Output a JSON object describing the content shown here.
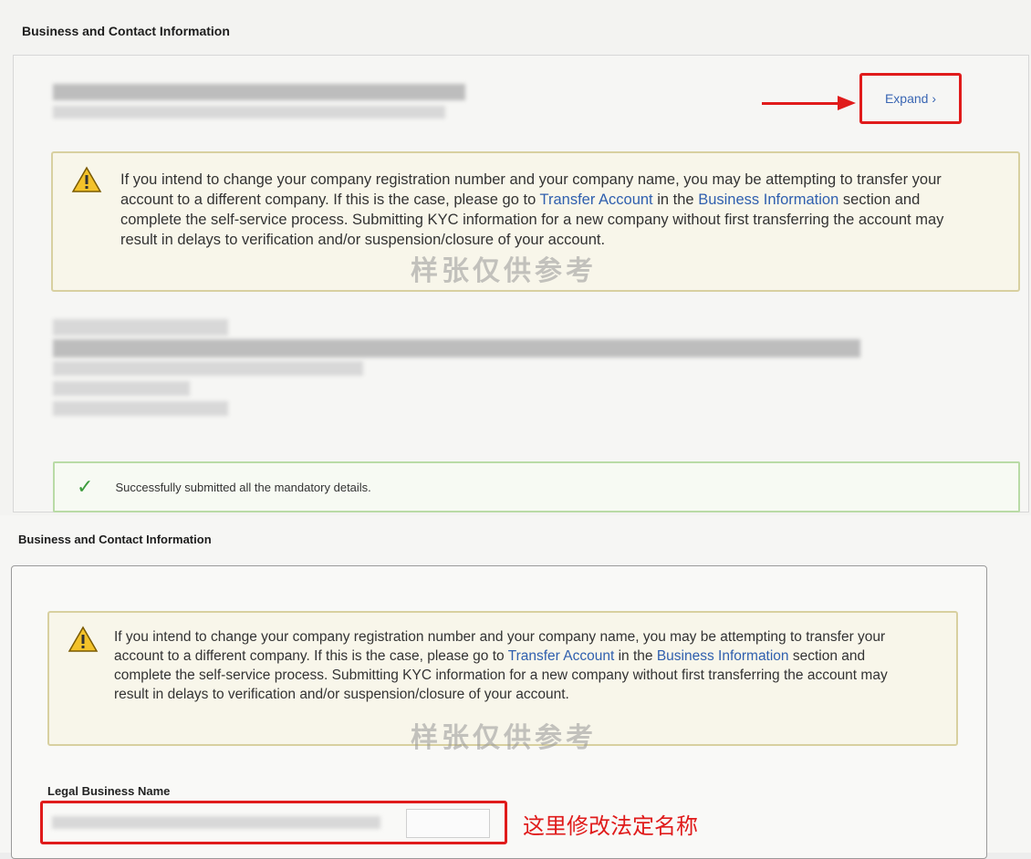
{
  "section1": {
    "title": "Business and Contact Information",
    "expand_label": "Expand ›",
    "warning": {
      "text_before_link1": "If you intend to change your company registration number and your company name, you may be attempting to transfer your account to a different company. If this is the case, please go to ",
      "link1": "Transfer Account",
      "text_between": " in the ",
      "link2": "Business Information",
      "text_after": " section and complete the self-service process. Submitting KYC information for a new company without first transferring the account may result in delays to verification and/or suspension/closure of your account."
    },
    "success_message": "Successfully submitted all the mandatory details.",
    "watermark": "样张仅供参考"
  },
  "section2": {
    "title": "Business and Contact Information",
    "warning": {
      "text_before_link1": "If you intend to change your company registration number and your company name, you may be attempting to transfer your account to a different company. If this is the case, please go to ",
      "link1": "Transfer Account",
      "text_between": " in the ",
      "link2": "Business Information",
      "text_after": " section and complete the self-service process. Submitting KYC information for a new company without first transferring the account may result in delays to verification and/or suspension/closure of your account."
    },
    "watermark": "样张仅供参考",
    "legal_name_label": "Legal Business Name",
    "legal_name_value": "",
    "annotation": "这里修改法定名称"
  },
  "colors": {
    "highlight": "#e01b1b",
    "link": "#2f5fae",
    "warning_border": "#d8d0a0",
    "success_border": "#b9dba6",
    "success_check": "#3c9b3c"
  },
  "icons": [
    "warning-triangle-icon",
    "checkmark-icon",
    "red-arrow-annotation"
  ]
}
